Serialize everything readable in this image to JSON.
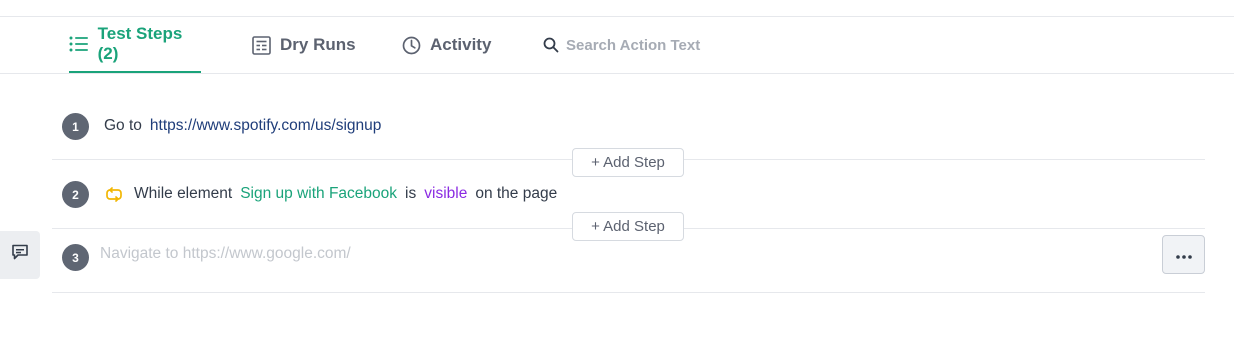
{
  "tabs": [
    {
      "label": "Test Steps (2)",
      "icon": "list-icon",
      "active": true
    },
    {
      "label": "Dry Runs",
      "icon": "dry-runs-icon",
      "active": false
    },
    {
      "label": "Activity",
      "icon": "clock-icon",
      "active": false
    }
  ],
  "search": {
    "placeholder": "Search Action Text",
    "icon": "search-icon"
  },
  "steps": [
    {
      "number": "1",
      "go_to": "Go to",
      "url": "https://www.spotify.com/us/signup"
    },
    {
      "number": "2",
      "icon": "loop-icon",
      "while_element": "While element",
      "element": "Sign up with Facebook",
      "is": "is",
      "state": "visible",
      "suffix": "on the page"
    },
    {
      "number": "3",
      "placeholder": "Navigate to https://www.google.com/"
    }
  ],
  "add_step_label": "+ Add Step",
  "colors": {
    "accent": "#1aa37a",
    "url": "#1f3d7a",
    "state": "#8a2be2",
    "badge": "#5f6673",
    "loop": "#f2b705"
  }
}
